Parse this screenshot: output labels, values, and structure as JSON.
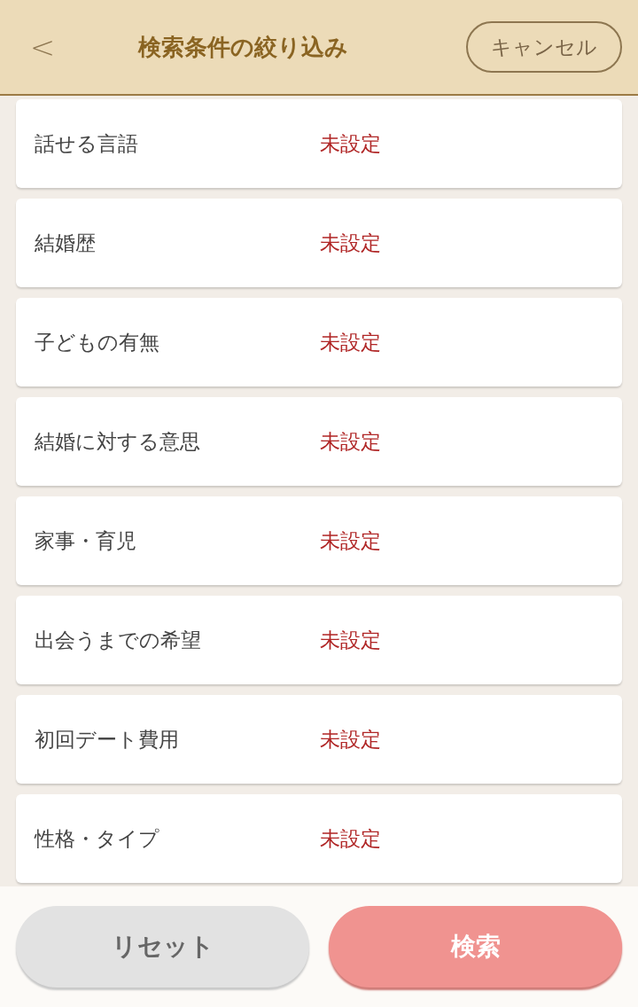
{
  "header": {
    "back": "<",
    "title": "検索条件の絞り込み",
    "cancel": "キャンセル"
  },
  "conditions": [
    {
      "label": "話せる言語",
      "value": "未設定"
    },
    {
      "label": "結婚歴",
      "value": "未設定"
    },
    {
      "label": "子どもの有無",
      "value": "未設定"
    },
    {
      "label": "結婚に対する意思",
      "value": "未設定"
    },
    {
      "label": "家事・育児",
      "value": "未設定"
    },
    {
      "label": "出会うまでの希望",
      "value": "未設定"
    },
    {
      "label": "初回デート費用",
      "value": "未設定"
    },
    {
      "label": "性格・タイプ",
      "value": "未設定"
    }
  ],
  "footer": {
    "reset": "リセット",
    "search": "検索"
  }
}
